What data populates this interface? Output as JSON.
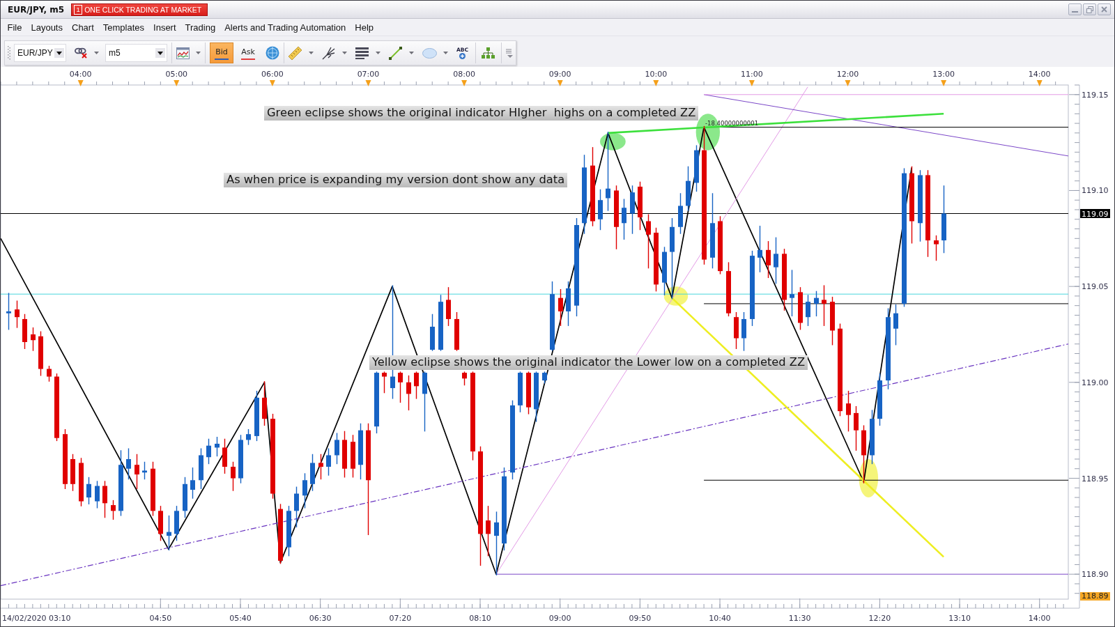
{
  "title_bar": {
    "title": "EUR/JPY, m5",
    "trading_button": {
      "number": "1",
      "label": "ONE CLICK TRADING AT MARKET"
    }
  },
  "menu": [
    "File",
    "Layouts",
    "Chart",
    "Templates",
    "Insert",
    "Trading",
    "Alerts and Trading Automation",
    "Help"
  ],
  "toolbar": {
    "symbol": "EUR/JPY",
    "timeframe": "m5",
    "price_buttons": [
      {
        "label": "Bid",
        "selected": true,
        "color": "#2f5fb8"
      },
      {
        "label": "Ask",
        "selected": false,
        "color": "#e23b3b"
      }
    ],
    "text_tool_label": "ABC"
  },
  "chart": {
    "chart_data": {
      "type": "candlestick",
      "x": [
        "2020-02-14T03:15",
        "2020-02-14T03:20",
        "2020-02-14T03:25",
        "2020-02-14T03:30",
        "2020-02-14T03:35",
        "2020-02-14T03:40",
        "2020-02-14T03:45",
        "2020-02-14T03:50",
        "2020-02-14T03:55",
        "2020-02-14T04:00",
        "2020-02-14T04:05",
        "2020-02-14T04:10",
        "2020-02-14T04:15",
        "2020-02-14T04:20",
        "2020-02-14T04:25",
        "2020-02-14T04:30",
        "2020-02-14T04:35",
        "2020-02-14T04:40",
        "2020-02-14T04:45",
        "2020-02-14T04:50",
        "2020-02-14T04:55",
        "2020-02-14T05:00",
        "2020-02-14T05:05",
        "2020-02-14T05:10",
        "2020-02-14T05:15",
        "2020-02-14T05:20",
        "2020-02-14T05:25",
        "2020-02-14T05:30",
        "2020-02-14T05:35",
        "2020-02-14T05:40",
        "2020-02-14T05:45",
        "2020-02-14T05:50",
        "2020-02-14T05:55",
        "2020-02-14T06:00",
        "2020-02-14T06:05",
        "2020-02-14T06:10",
        "2020-02-14T06:15",
        "2020-02-14T06:20",
        "2020-02-14T06:25",
        "2020-02-14T06:30",
        "2020-02-14T06:35",
        "2020-02-14T06:40",
        "2020-02-14T06:45",
        "2020-02-14T06:50",
        "2020-02-14T06:55",
        "2020-02-14T07:00",
        "2020-02-14T07:05",
        "2020-02-14T07:10",
        "2020-02-14T07:15",
        "2020-02-14T07:20",
        "2020-02-14T07:25",
        "2020-02-14T07:30",
        "2020-02-14T07:35",
        "2020-02-14T07:40",
        "2020-02-14T07:45",
        "2020-02-14T07:50",
        "2020-02-14T07:55",
        "2020-02-14T08:00",
        "2020-02-14T08:05",
        "2020-02-14T08:10",
        "2020-02-14T08:15",
        "2020-02-14T08:20",
        "2020-02-14T08:25",
        "2020-02-14T08:30",
        "2020-02-14T08:35",
        "2020-02-14T08:40",
        "2020-02-14T08:45",
        "2020-02-14T08:50",
        "2020-02-14T08:55",
        "2020-02-14T09:00",
        "2020-02-14T09:05",
        "2020-02-14T09:10",
        "2020-02-14T09:15",
        "2020-02-14T09:20",
        "2020-02-14T09:25",
        "2020-02-14T09:30",
        "2020-02-14T09:35",
        "2020-02-14T09:40",
        "2020-02-14T09:45",
        "2020-02-14T09:50",
        "2020-02-14T09:55",
        "2020-02-14T10:00",
        "2020-02-14T10:05",
        "2020-02-14T10:10",
        "2020-02-14T10:15",
        "2020-02-14T10:20",
        "2020-02-14T10:25",
        "2020-02-14T10:30",
        "2020-02-14T10:35",
        "2020-02-14T10:40",
        "2020-02-14T10:45",
        "2020-02-14T10:50",
        "2020-02-14T10:55",
        "2020-02-14T11:00",
        "2020-02-14T11:05",
        "2020-02-14T11:10",
        "2020-02-14T11:15",
        "2020-02-14T11:20",
        "2020-02-14T11:25",
        "2020-02-14T11:30",
        "2020-02-14T11:35",
        "2020-02-14T11:40",
        "2020-02-14T11:45",
        "2020-02-14T11:50",
        "2020-02-14T11:55",
        "2020-02-14T12:00",
        "2020-02-14T12:05",
        "2020-02-14T12:10",
        "2020-02-14T12:15",
        "2020-02-14T12:20",
        "2020-02-14T12:25",
        "2020-02-14T12:30",
        "2020-02-14T12:35",
        "2020-02-14T12:40",
        "2020-02-14T12:45",
        "2020-02-14T12:50",
        "2020-02-14T12:55",
        "2020-02-14T13:00"
      ],
      "ohlc": [
        [
          119.036,
          119.046,
          119.028,
          119.037
        ],
        [
          119.038,
          119.042,
          119.029,
          119.034
        ],
        [
          119.033,
          119.035,
          119.018,
          119.021
        ],
        [
          119.025,
          119.028,
          119.017,
          119.022
        ],
        [
          119.024,
          119.026,
          119.004,
          119.007
        ],
        [
          119.007,
          119.008,
          119.001,
          119.003
        ],
        [
          119.003,
          119.004,
          118.97,
          118.971
        ],
        [
          118.973,
          118.975,
          118.945,
          118.947
        ],
        [
          118.96,
          118.962,
          118.944,
          118.947
        ],
        [
          118.958,
          118.96,
          118.936,
          118.938
        ],
        [
          118.94,
          118.95,
          118.937,
          118.947
        ],
        [
          118.938,
          118.948,
          118.935,
          118.946
        ],
        [
          118.946,
          118.948,
          118.93,
          118.937
        ],
        [
          118.936,
          118.938,
          118.929,
          118.933
        ],
        [
          118.933,
          118.964,
          118.931,
          118.957
        ],
        [
          118.955,
          118.965,
          118.95,
          118.96
        ],
        [
          118.957,
          118.962,
          118.945,
          118.952
        ],
        [
          118.953,
          118.958,
          118.95,
          118.954
        ],
        [
          118.955,
          118.958,
          118.931,
          118.933
        ],
        [
          118.933,
          118.935,
          118.918,
          118.921
        ],
        [
          118.92,
          118.93,
          118.913,
          118.922
        ],
        [
          118.921,
          118.935,
          118.918,
          118.933
        ],
        [
          118.933,
          118.95,
          118.93,
          118.947
        ],
        [
          118.944,
          118.955,
          118.94,
          118.949
        ],
        [
          118.949,
          118.965,
          118.945,
          118.962
        ],
        [
          118.961,
          118.97,
          118.958,
          118.967
        ],
        [
          118.966,
          118.971,
          118.962,
          118.968
        ],
        [
          118.966,
          118.97,
          118.953,
          118.956
        ],
        [
          118.956,
          118.958,
          118.944,
          118.95
        ],
        [
          118.95,
          118.972,
          118.948,
          118.97
        ],
        [
          118.97,
          118.975,
          118.968,
          118.973
        ],
        [
          118.972,
          118.995,
          118.97,
          118.992
        ],
        [
          118.992,
          119.0,
          118.978,
          118.981
        ],
        [
          118.981,
          118.983,
          118.94,
          118.942
        ],
        [
          118.934,
          118.936,
          118.906,
          118.907
        ],
        [
          118.914,
          118.935,
          118.91,
          118.933
        ],
        [
          118.933,
          118.945,
          118.925,
          118.942
        ],
        [
          118.941,
          118.952,
          118.935,
          118.949
        ],
        [
          118.947,
          118.962,
          118.944,
          118.958
        ],
        [
          118.958,
          118.962,
          118.95,
          118.956
        ],
        [
          118.956,
          118.965,
          118.952,
          118.962
        ],
        [
          118.962,
          118.973,
          118.958,
          118.97
        ],
        [
          118.97,
          118.974,
          118.951,
          118.955
        ],
        [
          118.969,
          118.972,
          118.951,
          118.955
        ],
        [
          118.957,
          118.978,
          118.95,
          118.975
        ],
        [
          118.975,
          118.978,
          118.921,
          118.949
        ],
        [
          118.977,
          119.005,
          118.974,
          119.005
        ],
        [
          119.005,
          119.005,
          118.995,
          119.003
        ],
        [
          118.997,
          119.05,
          118.992,
          119.003
        ],
        [
          119.005,
          119.005,
          118.99,
          119.0
        ],
        [
          119.0,
          119.003,
          118.986,
          118.994
        ],
        [
          119.005,
          119.005,
          118.992,
          118.998
        ],
        [
          118.994,
          119.005,
          118.975,
          119.005
        ],
        [
          119.017,
          119.035,
          119.017,
          119.029
        ],
        [
          119.017,
          119.045,
          119.017,
          119.042
        ],
        [
          119.043,
          119.049,
          119.03,
          119.033
        ],
        [
          119.033,
          119.036,
          119.017,
          119.017
        ],
        [
          119.005,
          119.005,
          118.999,
          119.002
        ],
        [
          119.005,
          119.005,
          118.96,
          118.964
        ],
        [
          118.964,
          118.966,
          118.905,
          118.921
        ],
        [
          118.928,
          118.935,
          118.91,
          118.921
        ],
        [
          118.92,
          118.932,
          118.9,
          118.927
        ],
        [
          118.916,
          118.955,
          118.913,
          118.951
        ],
        [
          118.953,
          118.99,
          118.95,
          118.988
        ],
        [
          118.988,
          119.005,
          118.985,
          119.005
        ],
        [
          119.005,
          119.005,
          118.984,
          118.987
        ],
        [
          118.986,
          119.005,
          118.98,
          119.005
        ],
        [
          119.001,
          119.005,
          119.0,
          119.005
        ],
        [
          119.017,
          119.052,
          119.017,
          119.046
        ],
        [
          119.044,
          119.048,
          119.03,
          119.037
        ],
        [
          119.037,
          119.052,
          119.03,
          119.049
        ],
        [
          119.04,
          119.085,
          119.035,
          119.082
        ],
        [
          119.083,
          119.118,
          119.078,
          119.112
        ],
        [
          119.113,
          119.122,
          119.082,
          119.084
        ],
        [
          119.085,
          119.1,
          119.08,
          119.095
        ],
        [
          119.096,
          119.13,
          119.09,
          119.101
        ],
        [
          119.1,
          119.102,
          119.07,
          119.081
        ],
        [
          119.083,
          119.095,
          119.075,
          119.091
        ],
        [
          119.088,
          119.102,
          119.078,
          119.099
        ],
        [
          119.102,
          119.104,
          119.08,
          119.086
        ],
        [
          119.084,
          119.087,
          119.06,
          119.077
        ],
        [
          119.078,
          119.08,
          119.048,
          119.051
        ],
        [
          119.052,
          119.07,
          119.046,
          119.068
        ],
        [
          119.068,
          119.085,
          119.044,
          119.081
        ],
        [
          119.081,
          119.098,
          119.078,
          119.092
        ],
        [
          119.092,
          119.112,
          119.09,
          119.105
        ],
        [
          119.104,
          119.123,
          119.1,
          119.121
        ],
        [
          119.121,
          119.133,
          119.062,
          119.064
        ],
        [
          119.065,
          119.098,
          119.06,
          119.083
        ],
        [
          119.084,
          119.086,
          119.057,
          119.058
        ],
        [
          119.058,
          119.062,
          119.035,
          119.036
        ],
        [
          119.034,
          119.036,
          119.018,
          119.023
        ],
        [
          119.023,
          119.036,
          119.017,
          119.033
        ],
        [
          119.033,
          119.068,
          119.03,
          119.066
        ],
        [
          119.065,
          119.081,
          119.058,
          119.069
        ],
        [
          119.069,
          119.073,
          119.055,
          119.061
        ],
        [
          119.06,
          119.075,
          119.052,
          119.067
        ],
        [
          119.067,
          119.069,
          119.038,
          119.043
        ],
        [
          119.044,
          119.058,
          119.035,
          119.046
        ],
        [
          119.047,
          119.049,
          119.028,
          119.031
        ],
        [
          119.034,
          119.045,
          119.03,
          119.042
        ],
        [
          119.041,
          119.047,
          119.035,
          119.044
        ],
        [
          119.043,
          119.05,
          119.03,
          119.041
        ],
        [
          119.042,
          119.044,
          119.02,
          119.027
        ],
        [
          119.028,
          119.03,
          118.983,
          118.985
        ],
        [
          118.989,
          118.995,
          118.975,
          118.983
        ],
        [
          118.984,
          118.987,
          118.965,
          118.975
        ],
        [
          118.975,
          118.977,
          118.948,
          118.962
        ],
        [
          118.962,
          118.985,
          118.958,
          118.981
        ],
        [
          118.981,
          119.004,
          118.978,
          119.001
        ],
        [
          119.001,
          119.038,
          118.997,
          119.034
        ],
        [
          119.028,
          119.04,
          119.02,
          119.036
        ],
        [
          119.041,
          119.111,
          119.04,
          119.109
        ],
        [
          119.109,
          119.112,
          119.073,
          119.084
        ],
        [
          119.083,
          119.11,
          119.074,
          119.108
        ],
        [
          119.108,
          119.11,
          119.066,
          119.074
        ],
        [
          119.074,
          119.076,
          119.064,
          119.072
        ],
        [
          119.074,
          119.102,
          119.068,
          119.088
        ]
      ],
      "series": [
        {
          "type": "line",
          "color": "#000000",
          "x": [
            "2020-02-14T03:10",
            "2020-02-14T04:55",
            "2020-02-14T05:55",
            "2020-02-14T06:05",
            "2020-02-14T07:15",
            "2020-02-14T08:20",
            "2020-02-14T09:30",
            "2020-02-14T10:10",
            "2020-02-14T10:30",
            "2020-02-14T12:10",
            "2020-02-14T12:40"
          ],
          "values": [
            119.075,
            118.913,
            119.0,
            118.906,
            119.05,
            118.9,
            119.13,
            119.044,
            119.133,
            118.948,
            119.112
          ]
        },
        {
          "type": "line",
          "line_style": "dashdot",
          "color": "#6a35c0",
          "x": [
            "2020-02-14T03:10",
            "2020-02-14T14:18"
          ],
          "values": [
            118.894,
            119.02
          ]
        },
        {
          "type": "line",
          "color": "#e39be6",
          "x": [
            "2020-02-14T08:20",
            "2020-02-14T11:35"
          ],
          "values": [
            118.9,
            119.154
          ]
        },
        {
          "type": "line",
          "color": "#7b47c8",
          "x": [
            "2020-02-14T10:30",
            "2020-02-14T14:18"
          ],
          "values": [
            119.15,
            119.118
          ]
        },
        {
          "type": "line",
          "color": "#e39be6",
          "x": [
            "2020-02-14T10:30",
            "2020-02-14T14:18"
          ],
          "values": [
            119.15,
            119.15
          ]
        },
        {
          "type": "line",
          "color": "#000000",
          "x": [
            "2020-02-14T10:30",
            "2020-02-14T14:18"
          ],
          "values": [
            119.133,
            119.133
          ]
        },
        {
          "type": "line",
          "color": "#000000",
          "x": [
            "2020-02-14T10:30",
            "2020-02-14T14:18"
          ],
          "values": [
            119.041,
            119.041
          ]
        },
        {
          "type": "line",
          "color": "#000000",
          "x": [
            "2020-02-14T10:30",
            "2020-02-14T14:18"
          ],
          "values": [
            118.949,
            118.949
          ]
        },
        {
          "type": "line",
          "color": "#7b47c8",
          "x": [
            "2020-02-14T08:20",
            "2020-02-14T14:18"
          ],
          "values": [
            118.9,
            118.9
          ]
        },
        {
          "type": "line",
          "color": "#eeee22",
          "x": [
            "2020-02-14T10:10",
            "2020-02-14T13:00"
          ],
          "values": [
            119.044,
            118.909
          ]
        },
        {
          "type": "line",
          "color": "#3ce03c",
          "x": [
            "2020-02-14T09:30",
            "2020-02-14T13:00"
          ],
          "values": [
            119.13,
            119.14
          ]
        }
      ],
      "ref_lines": [
        {
          "axis": "y",
          "value": 119.046,
          "color": "#48d6dc"
        },
        {
          "axis": "y",
          "value": 119.088,
          "label": "119.09",
          "color": "#000000"
        }
      ],
      "annotations": [
        "Green eclipse shows the original indicator HIgher  highs on a completed ZZ",
        "As when price is expanding my version dont show any data",
        "Yellow eclipse shows the original indicator the Lower low on a completed ZZ",
        "-18.40000000001",
        "118.89"
      ],
      "xlim": [
        "2020-02-14T03:10",
        "2020-02-14T14:18"
      ],
      "x2lim": [
        "2020-02-14T03:10",
        "2020-02-14T14:18"
      ],
      "ylim": [
        118.887,
        119.155
      ],
      "yticks": [
        {
          "value": 118.9,
          "label": "118.90"
        },
        {
          "value": 118.95,
          "label": "118.95"
        },
        {
          "value": 119.0,
          "label": "119.00"
        },
        {
          "value": 119.05,
          "label": "119.05"
        },
        {
          "value": 119.1,
          "label": "119.10"
        },
        {
          "value": 119.15,
          "label": "119.15"
        }
      ],
      "xticks": [
        {
          "value": "2020-02-14T03:10",
          "label": "14/02/2020 03:10"
        },
        {
          "value": "2020-02-14T04:50",
          "label": "04:50"
        },
        {
          "value": "2020-02-14T05:40",
          "label": "05:40"
        },
        {
          "value": "2020-02-14T06:30",
          "label": "06:30"
        },
        {
          "value": "2020-02-14T07:20",
          "label": "07:20"
        },
        {
          "value": "2020-02-14T08:10",
          "label": "08:10"
        },
        {
          "value": "2020-02-14T09:00",
          "label": "09:00"
        },
        {
          "value": "2020-02-14T09:50",
          "label": "09:50"
        },
        {
          "value": "2020-02-14T10:40",
          "label": "10:40"
        },
        {
          "value": "2020-02-14T11:30",
          "label": "11:30"
        },
        {
          "value": "2020-02-14T12:20",
          "label": "12:20"
        },
        {
          "value": "2020-02-14T13:10",
          "label": "13:10"
        },
        {
          "value": "2020-02-14T14:00",
          "label": "14:00"
        }
      ],
      "x2ticks": [
        {
          "value": "2020-02-14T04:00",
          "label": "04:00"
        },
        {
          "value": "2020-02-14T05:00",
          "label": "05:00"
        },
        {
          "value": "2020-02-14T06:00",
          "label": "06:00"
        },
        {
          "value": "2020-02-14T07:00",
          "label": "07:00"
        },
        {
          "value": "2020-02-14T08:00",
          "label": "08:00"
        },
        {
          "value": "2020-02-14T09:00",
          "label": "09:00"
        },
        {
          "value": "2020-02-14T10:00",
          "label": "10:00"
        },
        {
          "value": "2020-02-14T11:00",
          "label": "11:00"
        },
        {
          "value": "2020-02-14T12:00",
          "label": "12:00"
        },
        {
          "value": "2020-02-14T13:00",
          "label": "13:00"
        },
        {
          "value": "2020-02-14T14:00",
          "label": "14:00"
        }
      ]
    }
  }
}
